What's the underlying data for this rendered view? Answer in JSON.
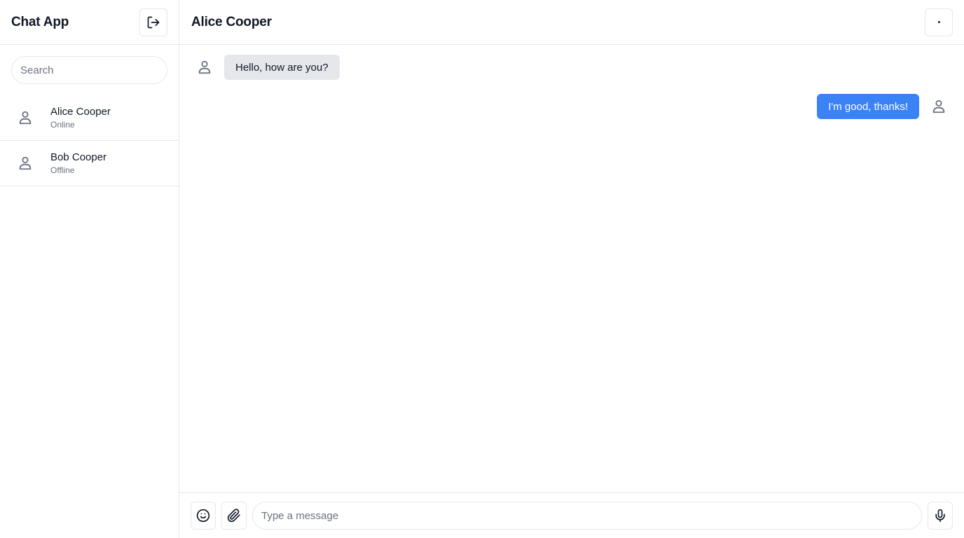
{
  "sidebar": {
    "title": "Chat App",
    "logout_icon": "logout-icon",
    "search": {
      "placeholder": "Search",
      "value": ""
    },
    "contacts": [
      {
        "name": "Alice Cooper",
        "status": "Online",
        "icon": "user-icon"
      },
      {
        "name": "Bob Cooper",
        "status": "Offline",
        "icon": "user-icon"
      }
    ]
  },
  "chat": {
    "title": "Alice Cooper",
    "menu_icon": "dot-icon",
    "messages": [
      {
        "direction": "incoming",
        "text": "Hello, how are you?"
      },
      {
        "direction": "outgoing",
        "text": "I'm good, thanks!"
      }
    ]
  },
  "composer": {
    "placeholder": "Type a message",
    "value": "",
    "emoji_icon": "smile-icon",
    "attach_icon": "paperclip-icon",
    "mic_icon": "microphone-icon"
  },
  "colors": {
    "accent": "#3b82f6",
    "incoming_bubble": "#e5e7eb",
    "border": "#e5e7eb",
    "muted_text": "#6b7280"
  }
}
